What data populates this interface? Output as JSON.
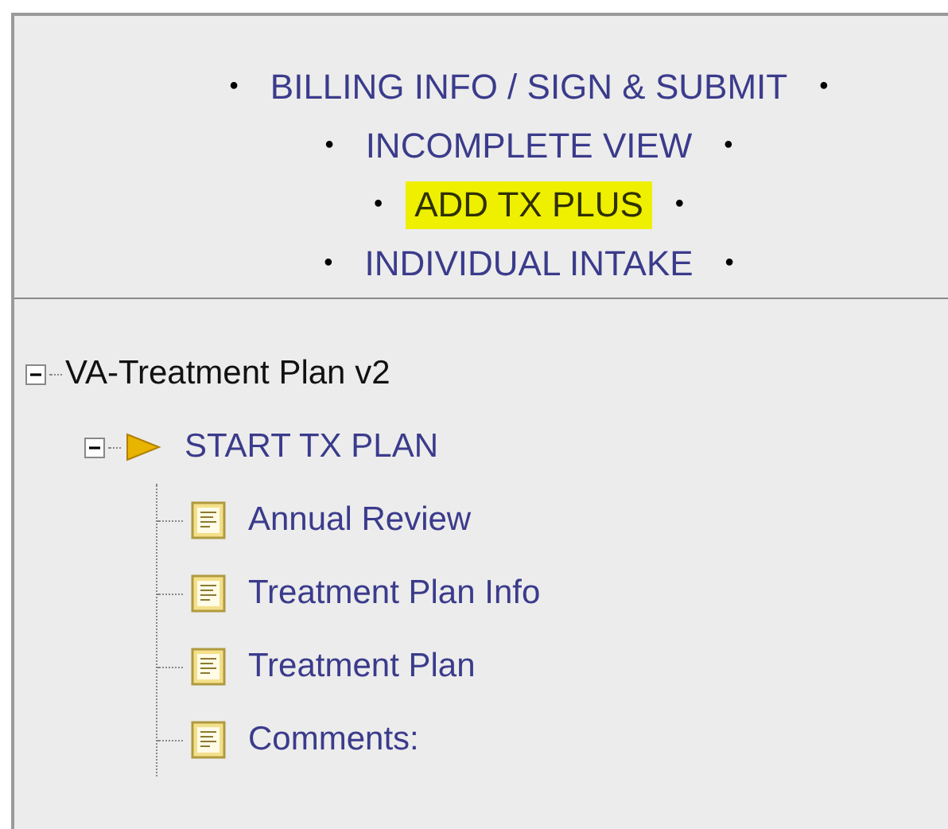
{
  "links": [
    {
      "label": "BILLING INFO / SIGN & SUBMIT",
      "bullet_left": "•",
      "bullet_right": "•",
      "highlighted": false
    },
    {
      "label": "INCOMPLETE VIEW",
      "bullet_left": "•",
      "bullet_right": "•",
      "highlighted": false
    },
    {
      "label": "ADD TX PLUS",
      "bullet_left": "•",
      "bullet_right": "•",
      "highlighted": true
    },
    {
      "label": "INDIVIDUAL INTAKE",
      "bullet_left": "•",
      "bullet_right": "•",
      "highlighted": false
    }
  ],
  "tree": [
    {
      "label": "VA-Treatment Plan v2",
      "kind": "root",
      "expanded": true,
      "children": [
        {
          "label": "START TX PLAN",
          "kind": "start",
          "expanded": true,
          "children": [
            {
              "label": "Annual Review",
              "kind": "form"
            },
            {
              "label": "Treatment Plan Info",
              "kind": "form"
            },
            {
              "label": "Treatment Plan",
              "kind": "form"
            },
            {
              "label": "Comments:",
              "kind": "form"
            }
          ]
        }
      ]
    }
  ]
}
